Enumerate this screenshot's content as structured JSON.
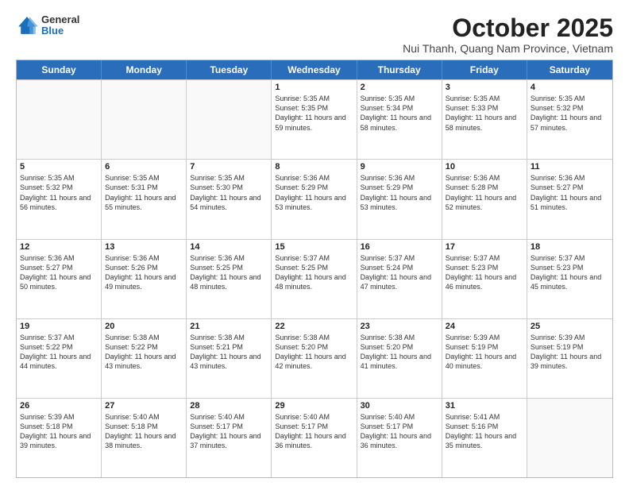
{
  "header": {
    "logo": {
      "general": "General",
      "blue": "Blue"
    },
    "title": "October 2025",
    "location": "Nui Thanh, Quang Nam Province, Vietnam"
  },
  "weekdays": [
    "Sunday",
    "Monday",
    "Tuesday",
    "Wednesday",
    "Thursday",
    "Friday",
    "Saturday"
  ],
  "weeks": [
    [
      {
        "day": "",
        "empty": true
      },
      {
        "day": "",
        "empty": true
      },
      {
        "day": "",
        "empty": true
      },
      {
        "day": "1",
        "sunrise": "5:35 AM",
        "sunset": "5:35 PM",
        "daylight": "11 hours and 59 minutes."
      },
      {
        "day": "2",
        "sunrise": "5:35 AM",
        "sunset": "5:34 PM",
        "daylight": "11 hours and 58 minutes."
      },
      {
        "day": "3",
        "sunrise": "5:35 AM",
        "sunset": "5:33 PM",
        "daylight": "11 hours and 58 minutes."
      },
      {
        "day": "4",
        "sunrise": "5:35 AM",
        "sunset": "5:32 PM",
        "daylight": "11 hours and 57 minutes."
      }
    ],
    [
      {
        "day": "5",
        "sunrise": "5:35 AM",
        "sunset": "5:32 PM",
        "daylight": "11 hours and 56 minutes."
      },
      {
        "day": "6",
        "sunrise": "5:35 AM",
        "sunset": "5:31 PM",
        "daylight": "11 hours and 55 minutes."
      },
      {
        "day": "7",
        "sunrise": "5:35 AM",
        "sunset": "5:30 PM",
        "daylight": "11 hours and 54 minutes."
      },
      {
        "day": "8",
        "sunrise": "5:36 AM",
        "sunset": "5:29 PM",
        "daylight": "11 hours and 53 minutes."
      },
      {
        "day": "9",
        "sunrise": "5:36 AM",
        "sunset": "5:29 PM",
        "daylight": "11 hours and 53 minutes."
      },
      {
        "day": "10",
        "sunrise": "5:36 AM",
        "sunset": "5:28 PM",
        "daylight": "11 hours and 52 minutes."
      },
      {
        "day": "11",
        "sunrise": "5:36 AM",
        "sunset": "5:27 PM",
        "daylight": "11 hours and 51 minutes."
      }
    ],
    [
      {
        "day": "12",
        "sunrise": "5:36 AM",
        "sunset": "5:27 PM",
        "daylight": "11 hours and 50 minutes."
      },
      {
        "day": "13",
        "sunrise": "5:36 AM",
        "sunset": "5:26 PM",
        "daylight": "11 hours and 49 minutes."
      },
      {
        "day": "14",
        "sunrise": "5:36 AM",
        "sunset": "5:25 PM",
        "daylight": "11 hours and 48 minutes."
      },
      {
        "day": "15",
        "sunrise": "5:37 AM",
        "sunset": "5:25 PM",
        "daylight": "11 hours and 48 minutes."
      },
      {
        "day": "16",
        "sunrise": "5:37 AM",
        "sunset": "5:24 PM",
        "daylight": "11 hours and 47 minutes."
      },
      {
        "day": "17",
        "sunrise": "5:37 AM",
        "sunset": "5:23 PM",
        "daylight": "11 hours and 46 minutes."
      },
      {
        "day": "18",
        "sunrise": "5:37 AM",
        "sunset": "5:23 PM",
        "daylight": "11 hours and 45 minutes."
      }
    ],
    [
      {
        "day": "19",
        "sunrise": "5:37 AM",
        "sunset": "5:22 PM",
        "daylight": "11 hours and 44 minutes."
      },
      {
        "day": "20",
        "sunrise": "5:38 AM",
        "sunset": "5:22 PM",
        "daylight": "11 hours and 43 minutes."
      },
      {
        "day": "21",
        "sunrise": "5:38 AM",
        "sunset": "5:21 PM",
        "daylight": "11 hours and 43 minutes."
      },
      {
        "day": "22",
        "sunrise": "5:38 AM",
        "sunset": "5:20 PM",
        "daylight": "11 hours and 42 minutes."
      },
      {
        "day": "23",
        "sunrise": "5:38 AM",
        "sunset": "5:20 PM",
        "daylight": "11 hours and 41 minutes."
      },
      {
        "day": "24",
        "sunrise": "5:39 AM",
        "sunset": "5:19 PM",
        "daylight": "11 hours and 40 minutes."
      },
      {
        "day": "25",
        "sunrise": "5:39 AM",
        "sunset": "5:19 PM",
        "daylight": "11 hours and 39 minutes."
      }
    ],
    [
      {
        "day": "26",
        "sunrise": "5:39 AM",
        "sunset": "5:18 PM",
        "daylight": "11 hours and 39 minutes."
      },
      {
        "day": "27",
        "sunrise": "5:40 AM",
        "sunset": "5:18 PM",
        "daylight": "11 hours and 38 minutes."
      },
      {
        "day": "28",
        "sunrise": "5:40 AM",
        "sunset": "5:17 PM",
        "daylight": "11 hours and 37 minutes."
      },
      {
        "day": "29",
        "sunrise": "5:40 AM",
        "sunset": "5:17 PM",
        "daylight": "11 hours and 36 minutes."
      },
      {
        "day": "30",
        "sunrise": "5:40 AM",
        "sunset": "5:17 PM",
        "daylight": "11 hours and 36 minutes."
      },
      {
        "day": "31",
        "sunrise": "5:41 AM",
        "sunset": "5:16 PM",
        "daylight": "11 hours and 35 minutes."
      },
      {
        "day": "",
        "empty": true
      }
    ]
  ],
  "labels": {
    "sunrise": "Sunrise:",
    "sunset": "Sunset:",
    "daylight": "Daylight:"
  }
}
